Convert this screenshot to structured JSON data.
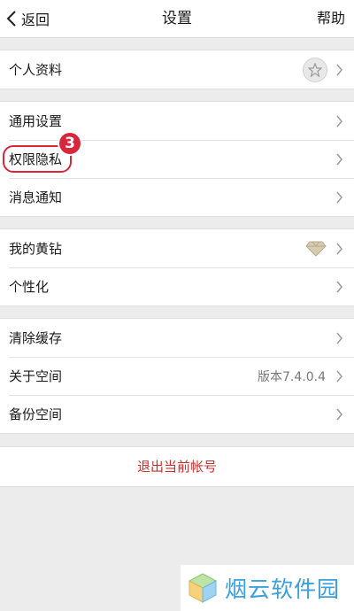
{
  "navbar": {
    "back_label": "返回",
    "title": "设置",
    "help_label": "帮助"
  },
  "groups": [
    {
      "items": [
        {
          "label": "个人资料",
          "accessory": "star-icon"
        }
      ]
    },
    {
      "items": [
        {
          "label": "通用设置"
        },
        {
          "label": "权限隐私",
          "annotation": "3"
        },
        {
          "label": "消息通知"
        }
      ]
    },
    {
      "items": [
        {
          "label": "我的黄钻",
          "accessory": "diamond-icon"
        },
        {
          "label": "个性化"
        }
      ]
    },
    {
      "items": [
        {
          "label": "清除缓存"
        },
        {
          "label": "关于空间",
          "value": "版本7.4.0.4"
        },
        {
          "label": "备份空间"
        }
      ]
    }
  ],
  "logout_label": "退出当前帐号",
  "watermark": {
    "text": "烟云软件园",
    "icon": "cube-logo"
  },
  "colors": {
    "accent_red": "#c8302e",
    "annotation_red": "#d9263b",
    "watermark_blue": "#3aa1dc"
  }
}
